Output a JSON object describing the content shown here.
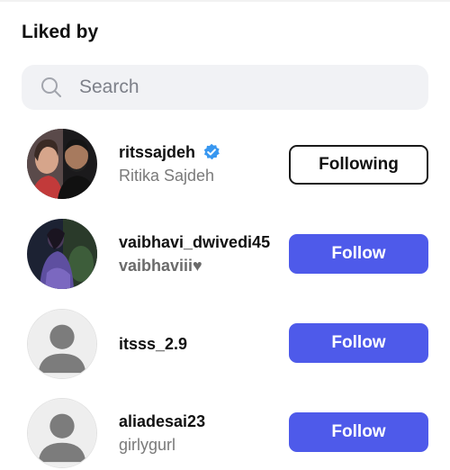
{
  "header": {
    "title": "Liked by"
  },
  "search": {
    "placeholder": "Search",
    "icon": "search-icon"
  },
  "users": [
    {
      "username": "ritssajdeh",
      "display_name": "Ritika Sajdeh",
      "verified": true,
      "button": "Following",
      "avatar": "photo-couple"
    },
    {
      "username": "vaibhavi_dwivedi45",
      "display_name": "vaibhaviii♥",
      "verified": false,
      "button": "Follow",
      "avatar": "photo-person"
    },
    {
      "username": "itsss_2.9",
      "display_name": "",
      "verified": false,
      "button": "Follow",
      "avatar": "default-avatar"
    },
    {
      "username": "aliadesai23",
      "display_name": "girlygurl",
      "verified": false,
      "button": "Follow",
      "avatar": "default-avatar"
    }
  ],
  "colors": {
    "follow_button": "#4e5aea",
    "verified_badge": "#3897f0",
    "search_bg": "#f1f2f5"
  }
}
